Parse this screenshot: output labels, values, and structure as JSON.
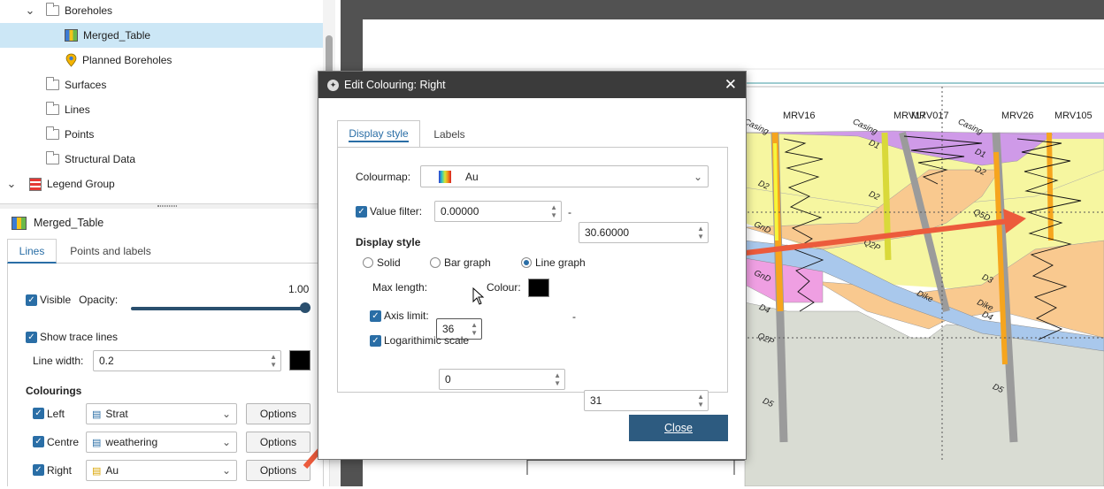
{
  "tree": {
    "items": [
      {
        "label": "Boreholes"
      },
      {
        "label": "Merged_Table"
      },
      {
        "label": "Planned Boreholes"
      },
      {
        "label": "Surfaces"
      },
      {
        "label": "Lines"
      },
      {
        "label": "Points"
      },
      {
        "label": "Structural Data"
      },
      {
        "label": "Legend Group"
      }
    ]
  },
  "properties": {
    "title": "Merged_Table",
    "tabs": [
      "Lines",
      "Points and labels"
    ],
    "visible_label": "Visible",
    "opacity_label": "Opacity:",
    "opacity_value": "1.00",
    "opacity_fraction": 1.0,
    "show_trace_label": "Show trace lines",
    "line_width_label": "Line width:",
    "line_width_value": "0.2",
    "colourings_heading": "Colourings",
    "colourings": [
      {
        "label": "Left",
        "value": "Strat",
        "button": "Options"
      },
      {
        "label": "Centre",
        "value": "weathering",
        "button": "Options"
      },
      {
        "label": "Right",
        "value": "Au",
        "button": "Options"
      }
    ]
  },
  "dialog": {
    "title": "Edit Colouring: Right",
    "tabs": [
      "Display style",
      "Labels"
    ],
    "colourmap_label": "Colourmap:",
    "colourmap_value": "Au",
    "value_filter_label": "Value filter:",
    "value_filter_min": "0.00000",
    "value_filter_sep": "-",
    "value_filter_max": "30.60000",
    "section_heading": "Display style",
    "style_options": [
      "Solid",
      "Bar graph",
      "Line graph"
    ],
    "style_selected": "Line graph",
    "max_length_label": "Max length:",
    "max_length_value": "36",
    "colour_label": "Colour:",
    "axis_limit_label": "Axis limit:",
    "axis_limit_min": "0",
    "axis_limit_sep": "-",
    "axis_limit_max": "31",
    "log_scale_label": "Logarithimic scale",
    "close_label": "Close"
  },
  "section": {
    "boreholes": [
      "MRV16",
      "MRV17",
      "MRV017",
      "MRV26",
      "MRV105"
    ],
    "units": [
      "Casing",
      "D1",
      "D2",
      "GnD",
      "Dike",
      "D4",
      "Q2P",
      "D5",
      "D3",
      "Q5D"
    ]
  },
  "colors": {
    "accent": "#2a6ea6",
    "close_button": "#2d5b80",
    "arrow": "#ec5b3c",
    "dialog_titlebar": "#3b3b3b",
    "selected_row": "#cce7f6"
  }
}
